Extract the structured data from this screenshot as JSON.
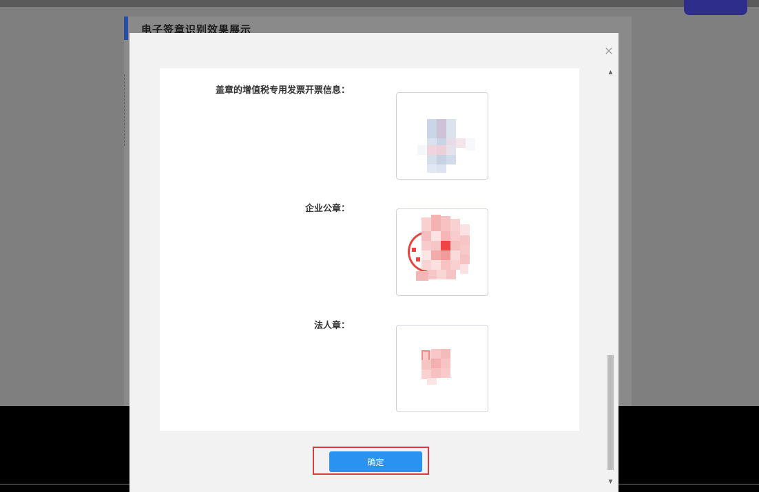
{
  "background_page": {
    "section_title": "电子签章识别效果展示"
  },
  "modal": {
    "close_glyph": "×",
    "fields": [
      {
        "label": "盖章的增值税专用发票开票信息：",
        "image": "invoice-stamp-image"
      },
      {
        "label": "企业公章：",
        "image": "company-seal-image"
      },
      {
        "label": "法人章：",
        "image": "legal-person-seal-image"
      }
    ],
    "confirm_label": "确定"
  },
  "scrollbar": {
    "up_glyph": "▲",
    "down_glyph": "▼"
  },
  "colors": {
    "primary_button": "#2a92f0",
    "highlight_border": "#e13a3a",
    "section_accent": "#2b4f9e",
    "seal_red": "#e8443f"
  }
}
